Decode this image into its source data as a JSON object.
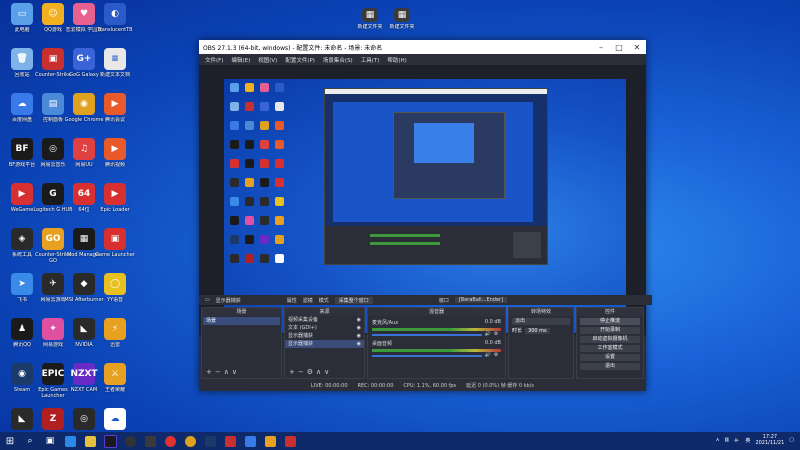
{
  "desktop": {
    "icons": [
      {
        "label": "此电脑",
        "color": "#5aa0e8",
        "glyph": "▭"
      },
      {
        "label": "QQ游戏",
        "color": "#f0b020",
        "glyph": "☺"
      },
      {
        "label": "恋爱模拟 学园篇",
        "color": "#e86090",
        "glyph": "♥"
      },
      {
        "label": "TranslucentTB",
        "color": "#2a5bc8",
        "glyph": "◐"
      },
      {
        "label": "回收站",
        "color": "#7fb2e8",
        "glyph": "🗑"
      },
      {
        "label": "Counter-Strike",
        "color": "#c83030",
        "glyph": "▣"
      },
      {
        "label": "GoG Galaxy",
        "color": "#3a63d8",
        "glyph": "G+"
      },
      {
        "label": "新建文本文档",
        "color": "#e8e8e8",
        "glyph": "≡"
      },
      {
        "label": "百度网盘",
        "color": "#3a7ae8",
        "glyph": "☁"
      },
      {
        "label": "控制面板",
        "color": "#4a8ad8",
        "glyph": "▤"
      },
      {
        "label": "Google Chrome",
        "color": "#e0a020",
        "glyph": "◉"
      },
      {
        "label": "腾讯会议",
        "color": "#e85a2a",
        "glyph": "▶"
      },
      {
        "label": "BF游戏平台",
        "color": "#1a1a1a",
        "glyph": "BF"
      },
      {
        "label": "网易云音乐",
        "color": "#1a1a1a",
        "glyph": "◎"
      },
      {
        "label": "网易UU",
        "color": "#e04040",
        "glyph": "♫"
      },
      {
        "label": "腾讯视频",
        "color": "#e85a2a",
        "glyph": "▶"
      },
      {
        "label": "WeGame",
        "color": "#d83030",
        "glyph": "▶"
      },
      {
        "label": "Logitech G HUB",
        "color": "#1a1a1a",
        "glyph": "G"
      },
      {
        "label": "64位",
        "color": "#d83030",
        "glyph": "64"
      },
      {
        "label": "Epic Loader",
        "color": "#d83030",
        "glyph": "▶"
      },
      {
        "label": "系统工具",
        "color": "#2a2a2a",
        "glyph": "◈"
      },
      {
        "label": "Counter-Strike GO",
        "color": "#e8a020",
        "glyph": "GO"
      },
      {
        "label": "Mod Manager",
        "color": "#1a1a1a",
        "glyph": "▦"
      },
      {
        "label": "Game Launcher",
        "color": "#d83030",
        "glyph": "▣"
      },
      {
        "label": "飞书",
        "color": "#3a8ae8",
        "glyph": "➤"
      },
      {
        "label": "网易云游戏",
        "color": "#2a2a2a",
        "glyph": "✈"
      },
      {
        "label": "MSI Afterburner",
        "color": "#2a2a2a",
        "glyph": "◆"
      },
      {
        "label": "YY语音",
        "color": "#e8c020",
        "glyph": "◯"
      },
      {
        "label": "腾讯QQ",
        "color": "#1a1a1a",
        "glyph": "♟"
      },
      {
        "label": "网易游戏",
        "color": "#e050a0",
        "glyph": "✦"
      },
      {
        "label": "NVIDIA",
        "color": "#2a2a2a",
        "glyph": "◣"
      },
      {
        "label": "迅雷",
        "color": "#e8a020",
        "glyph": "⚡"
      },
      {
        "label": "Steam",
        "color": "#1a3a6a",
        "glyph": "◉"
      },
      {
        "label": "Epic Games Launcher",
        "color": "#1a1a1a",
        "glyph": "EPIC"
      },
      {
        "label": "NZXT CAM",
        "color": "#6a2ac8",
        "glyph": "NZXT"
      },
      {
        "label": "王者荣耀",
        "color": "#e8a020",
        "glyph": "⚔"
      },
      {
        "label": "NVIDIA Broadcast",
        "color": "#2a2a2a",
        "glyph": "◣"
      },
      {
        "label": "Zotero",
        "color": "#b02020",
        "glyph": "Z"
      },
      {
        "label": "OBS Studio",
        "color": "#2a2a2a",
        "glyph": "◎"
      },
      {
        "label": "百度网盘",
        "color": "#ffffff",
        "glyph": "☁"
      }
    ],
    "top_files": [
      {
        "label": "新建文件夹"
      },
      {
        "label": "新建文件夹"
      }
    ]
  },
  "obs": {
    "title": "OBS 27.1.3 (64-bit, windows) - 配置文件: 未命名 - 场景: 未命名",
    "menu": [
      "文件(F)",
      "编辑(E)",
      "视图(V)",
      "配置文件(P)",
      "场景集合(S)",
      "工具(T)",
      "帮助(H)"
    ],
    "dock_bar": {
      "source": "显示器捕获",
      "properties": "属性",
      "filters": "滤镜",
      "mode": "模式",
      "mode_value": "采集整个窗口",
      "window_label": "窗口",
      "window_value": "[BeraBall...Ender]"
    },
    "docks": {
      "scenes": {
        "title": "场景",
        "items": [
          "场景"
        ]
      },
      "sources": {
        "title": "来源",
        "items": [
          "视频采集设备",
          "文本 (GDI+)",
          "显示器捕获",
          "显示器捕获"
        ]
      },
      "mixer": {
        "title": "混音器",
        "channels": [
          {
            "name": "麦克风/Aux",
            "level": "0.0 dB"
          },
          {
            "name": "桌面音频",
            "level": "0.0 dB"
          }
        ]
      },
      "transitions": {
        "title": "转场特效",
        "type": "淡出",
        "duration_label": "时长",
        "duration": "300 ms"
      },
      "controls": {
        "title": "控件",
        "buttons": [
          "停止推流",
          "开始录制",
          "启动虚拟摄像机",
          "工作室模式",
          "设置",
          "退出"
        ]
      }
    },
    "status": {
      "live": "LIVE: 00:00:00",
      "rec": "REC: 00:00:00",
      "cpu": "CPU: 1.1%, 60.00 fps",
      "info": "延迟 0 (0.0%) 帧 缓存 0 kb/s"
    }
  },
  "taskbar": {
    "time": "17:27",
    "date": "2021/11/21",
    "lang": "英"
  }
}
